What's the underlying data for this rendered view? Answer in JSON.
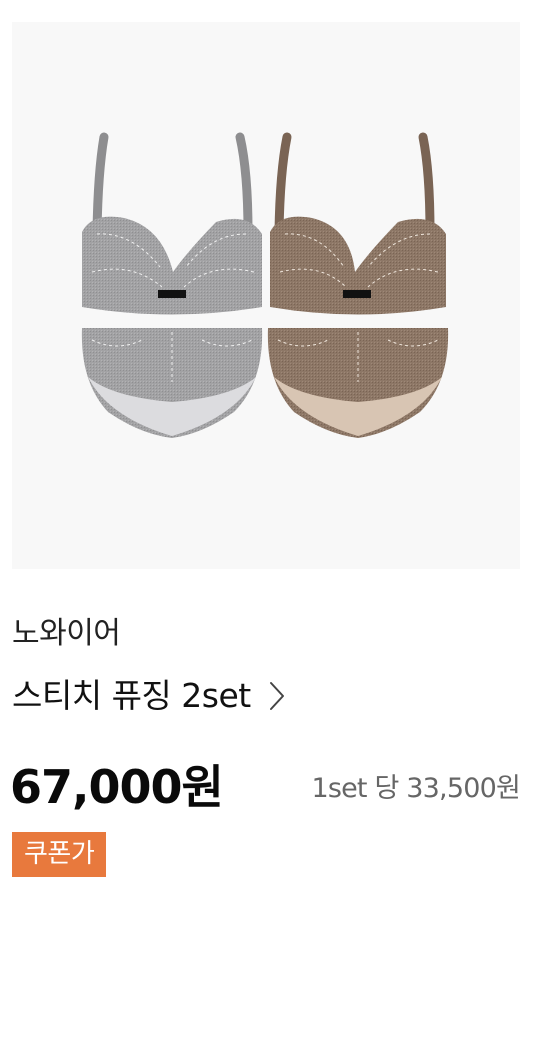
{
  "product": {
    "brand": "노와이어",
    "title": "스티치 퓨징 2set",
    "price": "67,000원",
    "unit_price": "1set 당 33,500원",
    "badge": "쿠폰가",
    "image_alt": "Stitch fusing bra and brief set in grey and brown"
  },
  "colors": {
    "image_bg": "#f8f8f8",
    "badge_bg": "#e8793d",
    "grey_set": "#9a9a9c",
    "brown_set": "#8b7563"
  },
  "icons": {
    "title_link": "chevron-right-icon"
  }
}
